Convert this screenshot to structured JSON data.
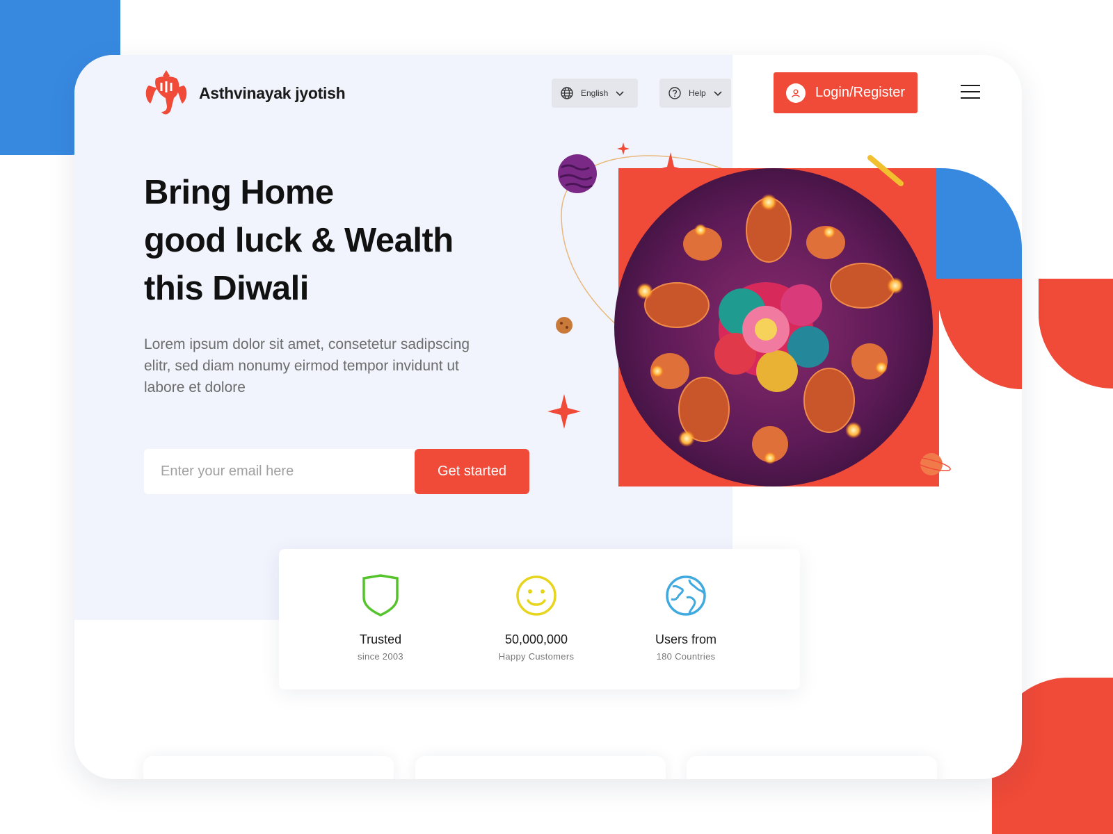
{
  "brand": {
    "name": "Asthvinayak jyotish"
  },
  "header": {
    "language": {
      "selected": "English"
    },
    "help": {
      "label": "Help"
    },
    "login_label": "Login/Register"
  },
  "hero": {
    "headline": [
      "Bring Home",
      "good luck & Wealth",
      "this Diwali"
    ],
    "subtext": "Lorem ipsum dolor sit amet, consetetur sadipscing elitr, sed diam nonumy eirmod tempor invidunt ut labore et dolore",
    "email_placeholder": "Enter your email here",
    "cta_label": "Get started"
  },
  "stats": [
    {
      "icon": "shield-icon",
      "title": "Trusted",
      "subtitle": "since 2003",
      "color": "#55c32c"
    },
    {
      "icon": "smiley-icon",
      "title": "50,000,000",
      "subtitle": "Happy Customers",
      "color": "#e6d51c"
    },
    {
      "icon": "globe-icon",
      "title": "Users from",
      "subtitle": "180 Countries",
      "color": "#3fa9e0"
    }
  ],
  "colors": {
    "accent": "#f04a38",
    "blue": "#3789e0",
    "hero_bg": "#f1f4fd"
  }
}
